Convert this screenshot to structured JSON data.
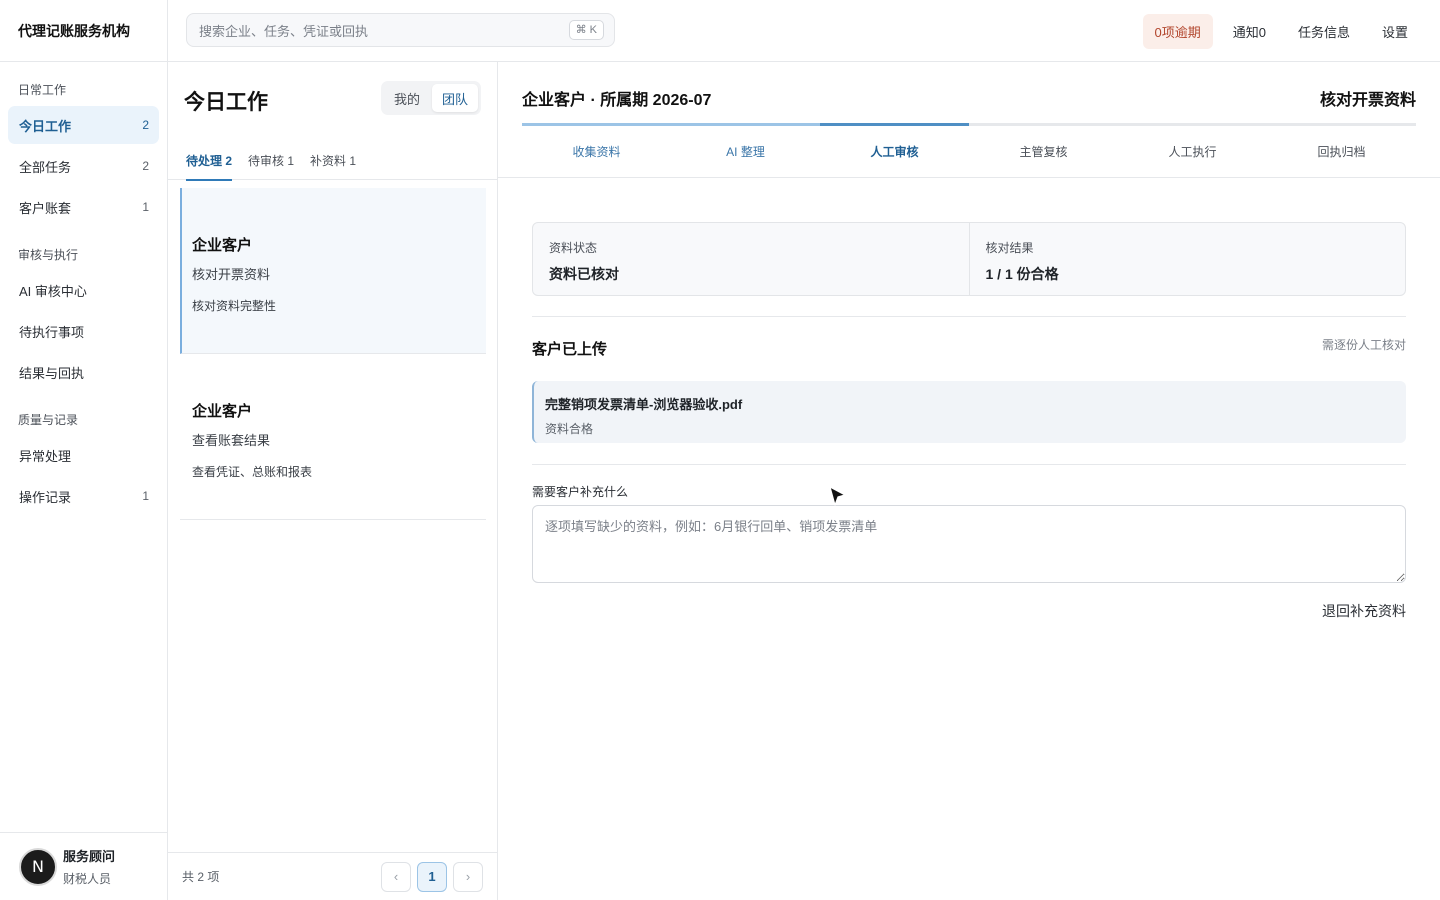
{
  "app": {
    "title": "代理记账服务机构"
  },
  "search": {
    "placeholder": "搜索企业、任务、凭证或回执",
    "shortcut": "⌘ K"
  },
  "topnav": {
    "overdue": "0项逾期",
    "notifications": "通知0",
    "task_info": "任务信息",
    "settings": "设置"
  },
  "sidebar": {
    "sections": [
      {
        "title": "日常工作",
        "items": [
          {
            "label": "今日工作",
            "count": "2",
            "active": true
          },
          {
            "label": "全部任务",
            "count": "2"
          },
          {
            "label": "客户账套",
            "count": "1"
          }
        ]
      },
      {
        "title": "审核与执行",
        "items": [
          {
            "label": "AI 审核中心",
            "count": ""
          },
          {
            "label": "待执行事项",
            "count": ""
          },
          {
            "label": "结果与回执",
            "count": ""
          }
        ]
      },
      {
        "title": "质量与记录",
        "items": [
          {
            "label": "异常处理",
            "count": ""
          },
          {
            "label": "操作记录",
            "count": "1"
          }
        ]
      }
    ],
    "user": {
      "initial": "N",
      "name": "服务顾问",
      "role": "财税人员"
    }
  },
  "list": {
    "title": "今日工作",
    "scope": {
      "mine": "我的",
      "team": "团队",
      "selected": "team"
    },
    "tabs": [
      {
        "label": "待处理 2",
        "active": true
      },
      {
        "label": "待审核 1"
      },
      {
        "label": "补资料 1"
      }
    ],
    "items": [
      {
        "company": "企业客户",
        "task": "核对开票资料",
        "desc": "核对资料完整性",
        "active": true
      },
      {
        "company": "企业客户",
        "task": "查看账套结果",
        "desc": "查看凭证、总账和报表"
      }
    ],
    "total": "共 2 项",
    "pager": {
      "prev": "‹",
      "current": "1",
      "next": "›"
    }
  },
  "detail": {
    "title": "企业客户 · 所属期 2026-07",
    "step_title": "核对开票资料",
    "steps": [
      {
        "label": "收集资料",
        "state": "done"
      },
      {
        "label": "AI 整理",
        "state": "done"
      },
      {
        "label": "人工审核",
        "state": "current"
      },
      {
        "label": "主管复核",
        "state": "todo"
      },
      {
        "label": "人工执行",
        "state": "todo"
      },
      {
        "label": "回执归档",
        "state": "todo"
      }
    ],
    "status": {
      "material_label": "资料状态",
      "material_value": "资料已核对",
      "result_label": "核对结果",
      "result_value": "1 / 1 份合格"
    },
    "uploaded": {
      "title": "客户已上传",
      "note": "需逐份人工核对",
      "files": [
        {
          "name": "完整销项发票清单-浏览器验收.pdf",
          "status": "资料合格"
        }
      ]
    },
    "supplement": {
      "label": "需要客户补充什么",
      "placeholder": "逐项填写缺少的资料，例如：6月银行回单、销项发票清单",
      "value": ""
    },
    "return_button": "退回补充资料"
  },
  "colors": {
    "accent": "#2f7ab8",
    "active_bg": "#eaf3fb",
    "overdue_bg": "#fbeee9",
    "overdue_text": "#b2452c"
  }
}
